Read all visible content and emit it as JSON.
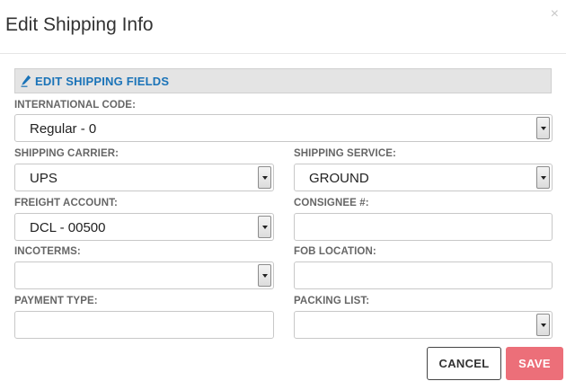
{
  "modal": {
    "title": "Edit Shipping Info",
    "close_symbol": "×"
  },
  "section": {
    "title": "EDIT SHIPPING FIELDS",
    "icon": "pencil-icon",
    "accent_color": "#1a73b8"
  },
  "fields": {
    "international_code": {
      "label": "INTERNATIONAL CODE:",
      "value": "Regular - 0"
    },
    "shipping_carrier": {
      "label": "SHIPPING CARRIER:",
      "value": "UPS"
    },
    "shipping_service": {
      "label": "SHIPPING SERVICE:",
      "value": "GROUND"
    },
    "freight_account": {
      "label": "FREIGHT ACCOUNT:",
      "value": "DCL - 00500"
    },
    "consignee": {
      "label": "CONSIGNEE #:",
      "value": ""
    },
    "incoterms": {
      "label": "INCOTERMS:",
      "value": ""
    },
    "fob_location": {
      "label": "FOB LOCATION:",
      "value": ""
    },
    "payment_type": {
      "label": "PAYMENT TYPE:",
      "value": ""
    },
    "packing_list": {
      "label": "PACKING LIST:",
      "value": ""
    }
  },
  "buttons": {
    "cancel": "CANCEL",
    "save": "SAVE",
    "save_color": "#ec6f79"
  }
}
